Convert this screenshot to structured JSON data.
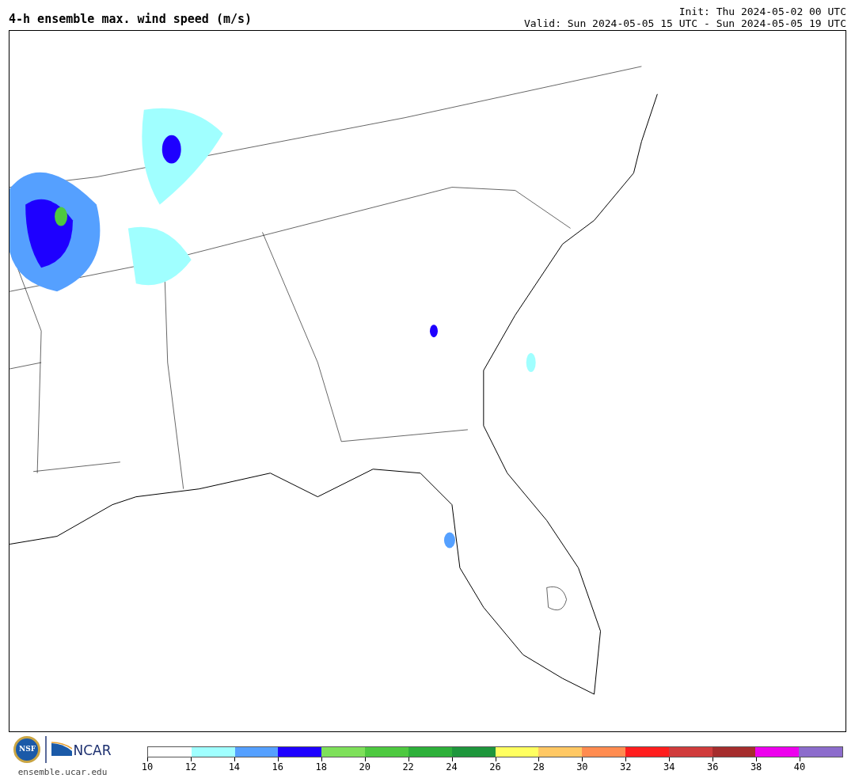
{
  "title": "4-h ensemble max. wind speed (m/s)",
  "init": "Init: Thu 2024-05-02 00 UTC",
  "valid": "Valid: Sun 2024-05-05 15 UTC - Sun 2024-05-05 19 UTC",
  "logos": {
    "nsf": "NSF",
    "ncar": "NCAR",
    "url": "ensemble.ucar.edu"
  },
  "colorbar": {
    "bins": [
      {
        "color": "#ffffff"
      },
      {
        "color": "#a0ffff"
      },
      {
        "color": "#55a0ff"
      },
      {
        "color": "#1e00ff"
      },
      {
        "color": "#7ee05a"
      },
      {
        "color": "#4ec940"
      },
      {
        "color": "#2eb03a"
      },
      {
        "color": "#1e963c"
      },
      {
        "color": "#ffff60"
      },
      {
        "color": "#ffc864"
      },
      {
        "color": "#ff8c50"
      },
      {
        "color": "#ff1e1e"
      },
      {
        "color": "#d03c3c"
      },
      {
        "color": "#a52d2d"
      },
      {
        "color": "#ee00ee"
      },
      {
        "color": "#8c6ccc"
      }
    ],
    "ticks": [
      "10",
      "12",
      "14",
      "16",
      "18",
      "20",
      "22",
      "24",
      "26",
      "28",
      "30",
      "32",
      "34",
      "36",
      "38",
      "40"
    ]
  }
}
